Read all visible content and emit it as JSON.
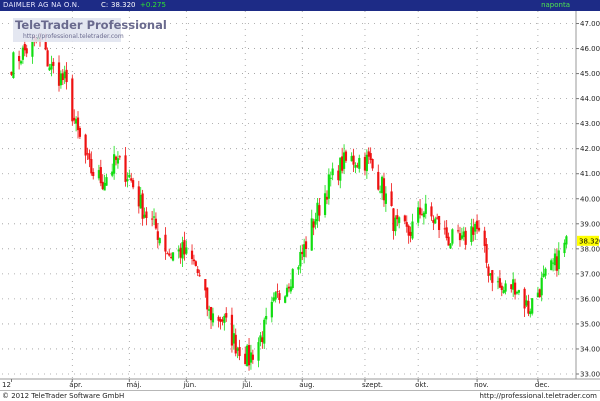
{
  "header": {
    "symbol": "DAIMLER AG NA O.N.",
    "last_label": "C:",
    "last_value": "38.320",
    "change": "+0.275",
    "period": "naponta"
  },
  "logo": {
    "title": "TeleTrader Professional",
    "url": "http://professional.teletrader.com"
  },
  "footer": {
    "copyright": "© 2012 TeleTrader Software GmbH",
    "url": "http://professional.teletrader.com"
  },
  "colors": {
    "up": "#11dd11",
    "down": "#ee1111",
    "header_bg": "#1d2b86",
    "last_price_tag": "#ffff00"
  },
  "chart_data": {
    "type": "candlestick",
    "title": "",
    "xlabel": "",
    "ylabel": "",
    "ylim": [
      32.8,
      47.5
    ],
    "y_axis_side": "right",
    "grid": true,
    "y_ticks": [
      "33.000",
      "34.000",
      "35.000",
      "36.000",
      "37.000",
      "38.000",
      "39.000",
      "40.000",
      "41.000",
      "42.000",
      "43.000",
      "44.000",
      "45.000",
      "46.000",
      "47.000"
    ],
    "x_ticks": [
      {
        "label": "12",
        "date": "2012-03-01"
      },
      {
        "label": "ápr.",
        "date": "2012-04-02"
      },
      {
        "label": "máj.",
        "date": "2012-05-02"
      },
      {
        "label": "jún.",
        "date": "2012-06-01"
      },
      {
        "label": "júl.",
        "date": "2012-07-02"
      },
      {
        "label": "aug.",
        "date": "2012-08-01"
      },
      {
        "label": "szept.",
        "date": "2012-09-03"
      },
      {
        "label": "okt.",
        "date": "2012-10-01"
      },
      {
        "label": "nov.",
        "date": "2012-11-01"
      },
      {
        "label": "dec.",
        "date": "2012-12-03"
      }
    ],
    "last_price": "38.320",
    "close_points": [
      [
        "2012-03-01",
        45.4
      ],
      [
        "2012-03-08",
        45.9
      ],
      [
        "2012-03-15",
        46.3
      ],
      [
        "2012-03-22",
        45.2
      ],
      [
        "2012-03-29",
        44.7
      ],
      [
        "2012-04-04",
        42.8
      ],
      [
        "2012-04-11",
        41.2
      ],
      [
        "2012-04-18",
        40.7
      ],
      [
        "2012-04-25",
        41.5
      ],
      [
        "2012-05-02",
        40.9
      ],
      [
        "2012-05-09",
        39.6
      ],
      [
        "2012-05-16",
        38.8
      ],
      [
        "2012-05-23",
        37.8
      ],
      [
        "2012-05-30",
        37.9
      ],
      [
        "2012-06-06",
        37.3
      ],
      [
        "2012-06-13",
        35.4
      ],
      [
        "2012-06-20",
        35.2
      ],
      [
        "2012-06-27",
        34.2
      ],
      [
        "2012-07-04",
        33.6
      ],
      [
        "2012-07-11",
        34.6
      ],
      [
        "2012-07-18",
        35.9
      ],
      [
        "2012-07-25",
        36.8
      ],
      [
        "2012-08-01",
        37.8
      ],
      [
        "2012-08-08",
        39.3
      ],
      [
        "2012-08-15",
        40.6
      ],
      [
        "2012-08-22",
        41.4
      ],
      [
        "2012-08-29",
        41.6
      ],
      [
        "2012-09-05",
        41.5
      ],
      [
        "2012-09-12",
        40.5
      ],
      [
        "2012-09-19",
        38.9
      ],
      [
        "2012-09-26",
        38.6
      ],
      [
        "2012-10-03",
        39.6
      ],
      [
        "2012-10-10",
        39.1
      ],
      [
        "2012-10-17",
        38.4
      ],
      [
        "2012-10-24",
        38.2
      ],
      [
        "2012-10-31",
        39.0
      ],
      [
        "2012-11-07",
        37.2
      ],
      [
        "2012-11-14",
        36.3
      ],
      [
        "2012-11-21",
        36.6
      ],
      [
        "2012-11-28",
        35.6
      ],
      [
        "2012-12-05",
        36.6
      ],
      [
        "2012-12-12",
        37.4
      ],
      [
        "2012-12-18",
        38.3
      ]
    ]
  }
}
